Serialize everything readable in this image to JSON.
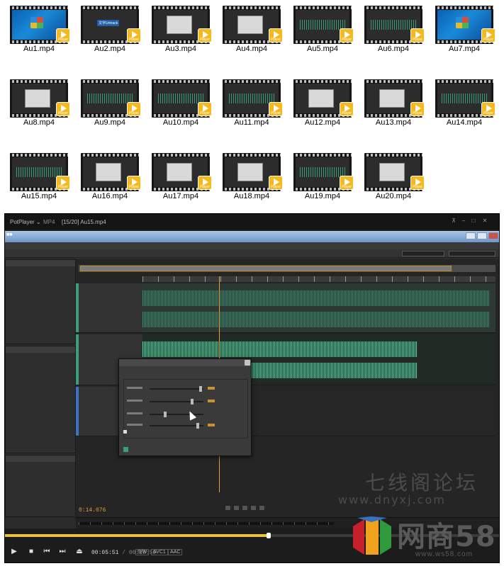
{
  "explorer": {
    "files": [
      {
        "name": "Au1.mp4",
        "thumb": "win"
      },
      {
        "name": "Au2.mp4",
        "thumb": "dark"
      },
      {
        "name": "Au3.mp4",
        "thumb": "panel"
      },
      {
        "name": "Au4.mp4",
        "thumb": "panel"
      },
      {
        "name": "Au5.mp4",
        "thumb": "wave"
      },
      {
        "name": "Au6.mp4",
        "thumb": "wave"
      },
      {
        "name": "Au7.mp4",
        "thumb": "win"
      },
      {
        "name": "Au8.mp4",
        "thumb": "panel"
      },
      {
        "name": "Au9.mp4",
        "thumb": "wave"
      },
      {
        "name": "Au10.mp4",
        "thumb": "wave"
      },
      {
        "name": "Au11.mp4",
        "thumb": "wave"
      },
      {
        "name": "Au12.mp4",
        "thumb": "panel"
      },
      {
        "name": "Au13.mp4",
        "thumb": "panel"
      },
      {
        "name": "Au14.mp4",
        "thumb": "wave"
      },
      {
        "name": "Au15.mp4",
        "thumb": "wave"
      },
      {
        "name": "Au16.mp4",
        "thumb": "panel"
      },
      {
        "name": "Au17.mp4",
        "thumb": "panel"
      },
      {
        "name": "Au18.mp4",
        "thumb": "panel"
      },
      {
        "name": "Au19.mp4",
        "thumb": "wave"
      },
      {
        "name": "Au20.mp4",
        "thumb": "panel"
      }
    ],
    "badge_label": "Player",
    "au2_caption": "文字Untrack"
  },
  "player": {
    "app_name": "PotPlayer",
    "format": "MP4",
    "now_playing": "[15/20] Au15.mp4",
    "video": {
      "timecode": "0:14.076",
      "watermark_cn": "七线阁论坛",
      "watermark_url": "www.dnyxj.com"
    },
    "progress_fraction": 0.533,
    "time_current": "00:05:51",
    "time_total": "00:10:59",
    "tags": [
      "S/W",
      "AVC1",
      "AAC"
    ],
    "accent_color": "#e7c23a"
  },
  "logo": {
    "name": "网商58",
    "url": "www.ws58.com"
  }
}
